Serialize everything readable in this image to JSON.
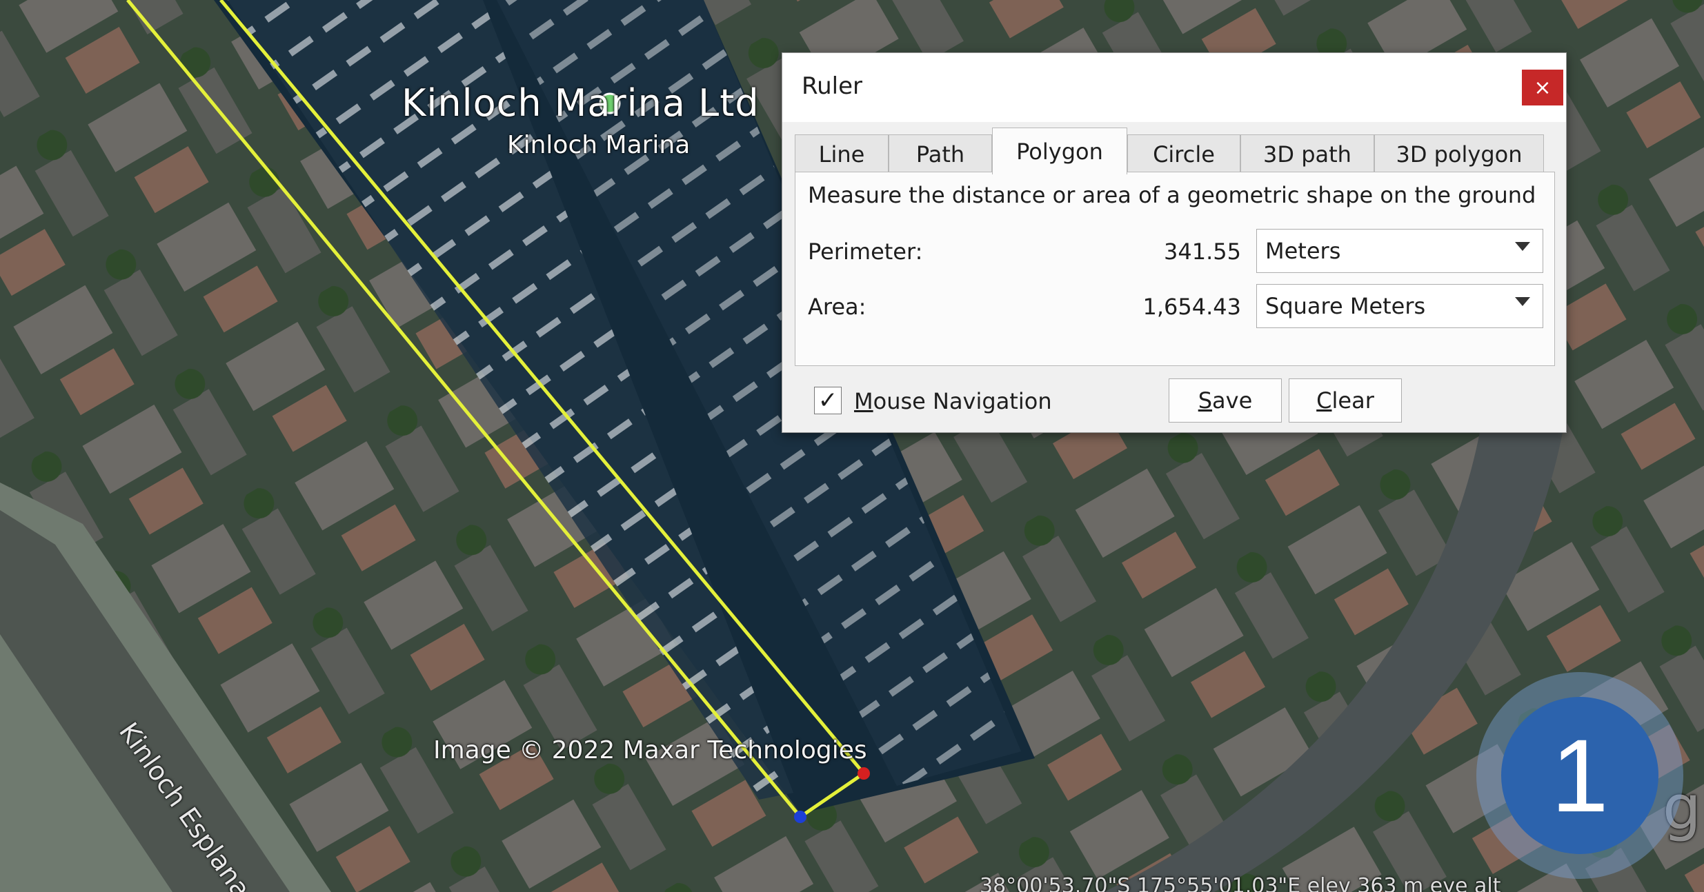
{
  "map": {
    "place_title": "Kinloch Marina Ltd",
    "place_subtitle": "Kinloch Marina",
    "street_name": "Kinloch Esplanade",
    "imagery_credit": "Image © 2022 Maxar Technologies",
    "coords_readout": "38°00'53.70\"S  175°55'01.03\"E  elev  363 m  eye alt",
    "brand_partial": "gle",
    "colors": {
      "measure_line": "#e4f03a",
      "vertex_start": "#1d3fd6",
      "vertex_end": "#d62020"
    }
  },
  "ruler": {
    "title": "Ruler",
    "close_icon": "close-icon",
    "close_glyph": "×",
    "tabs": [
      "Line",
      "Path",
      "Polygon",
      "Circle",
      "3D path",
      "3D polygon"
    ],
    "active_tab": "Polygon",
    "description": "Measure the distance or area of a geometric shape on the ground",
    "perimeter": {
      "label": "Perimeter:",
      "value": "341.55",
      "unit": "Meters"
    },
    "area": {
      "label": "Area:",
      "value": "1,654.43",
      "unit": "Square Meters"
    },
    "mouse_navigation": {
      "label_first": "M",
      "label_rest": "ouse Navigation",
      "checked": true,
      "check_glyph": "✓"
    },
    "save_button": {
      "first": "S",
      "rest": "ave"
    },
    "clear_button": {
      "first": "C",
      "rest": "lear"
    }
  },
  "step_badge": {
    "number": "1",
    "color": "#2c63ad"
  }
}
